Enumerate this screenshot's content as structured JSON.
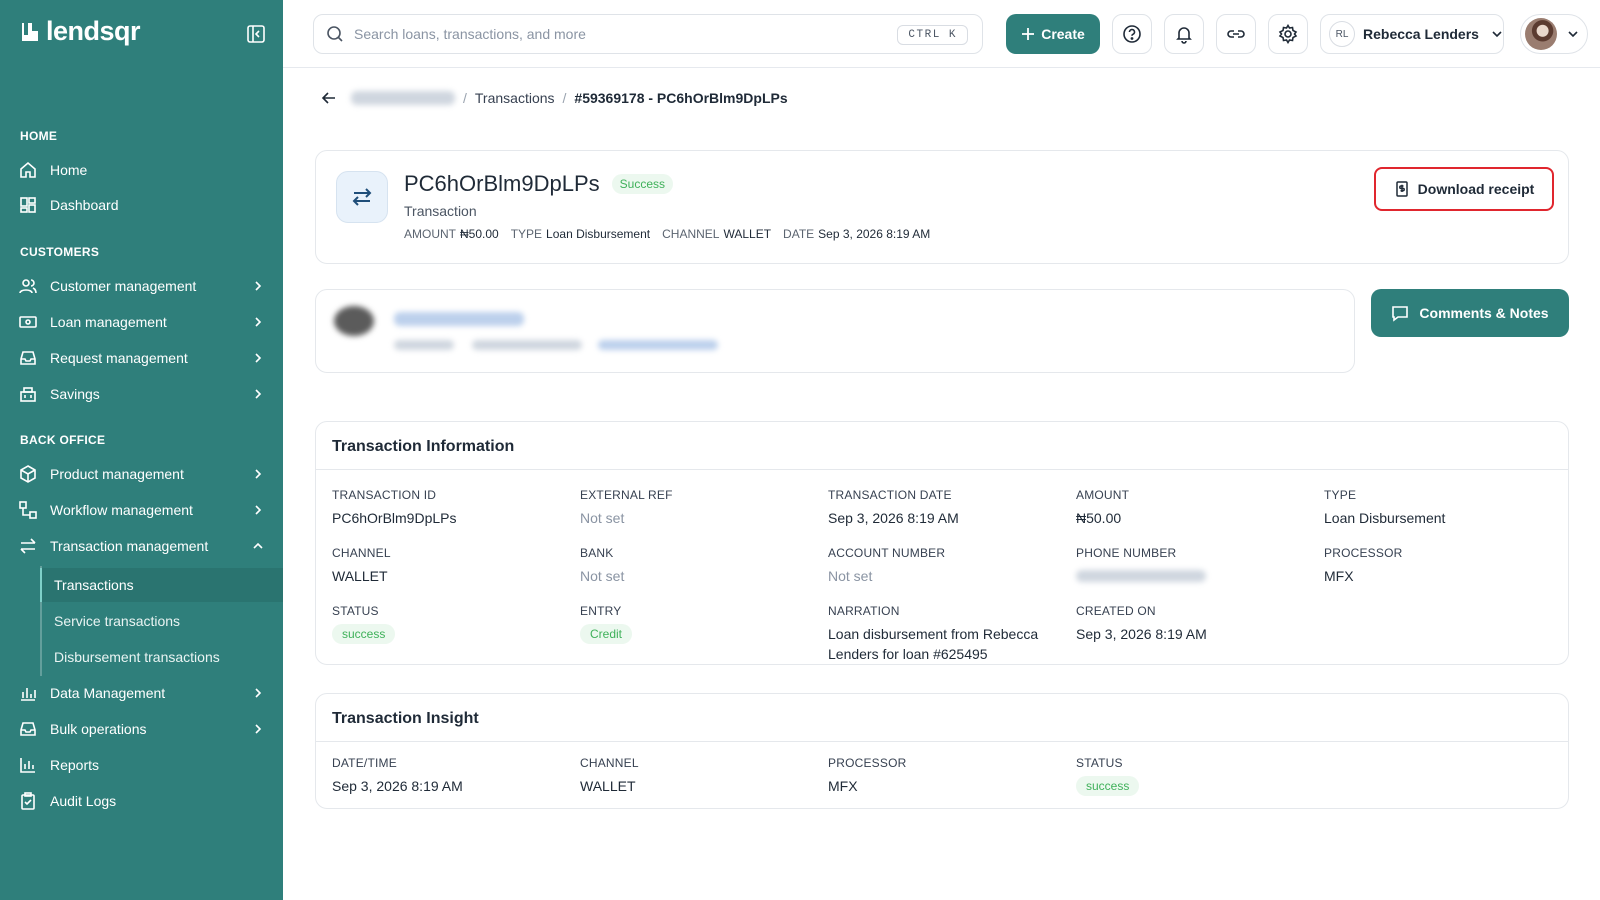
{
  "brand": {
    "name": "lendsqr"
  },
  "sidebar": {
    "sections": {
      "home": "HOME",
      "customers": "CUSTOMERS",
      "back_office": "BACK OFFICE"
    },
    "items": {
      "home": "Home",
      "dashboard": "Dashboard",
      "customer_management": "Customer management",
      "loan_management": "Loan management",
      "request_management": "Request management",
      "savings": "Savings",
      "product_management": "Product management",
      "workflow_management": "Workflow management",
      "transaction_management": "Transaction management",
      "data_management": "Data Management",
      "bulk_operations": "Bulk operations",
      "reports": "Reports",
      "audit_logs": "Audit Logs"
    },
    "sub_items": {
      "transactions": "Transactions",
      "service_transactions": "Service transactions",
      "disbursement_transactions": "Disbursement transactions"
    }
  },
  "topbar": {
    "search_placeholder": "Search loans, transactions, and more",
    "shortcut": "CTRL K",
    "create_label": "Create",
    "user_initials": "RL",
    "user_name": "Rebecca Lenders"
  },
  "breadcrumb": {
    "transactions": "Transactions",
    "current": "#59369178 - PC6hOrBlm9DpLPs"
  },
  "transaction": {
    "reference": "PC6hOrBlm9DpLPs",
    "status_badge": "Success",
    "subtitle": "Transaction",
    "meta": {
      "amount_label": "AMOUNT",
      "amount": "₦50.00",
      "type_label": "TYPE",
      "type": "Loan Disbursement",
      "channel_label": "CHANNEL",
      "channel": "WALLET",
      "date_label": "DATE",
      "date": "Sep 3, 2026 8:19 AM"
    },
    "download_label": "Download receipt"
  },
  "comments_label": "Comments & Notes",
  "info": {
    "title": "Transaction Information",
    "fields": {
      "transaction_id": {
        "label": "TRANSACTION ID",
        "value": "PC6hOrBlm9DpLPs"
      },
      "external_ref": {
        "label": "EXTERNAL REF",
        "value": "Not set"
      },
      "transaction_date": {
        "label": "TRANSACTION DATE",
        "value": "Sep 3, 2026 8:19 AM"
      },
      "amount": {
        "label": "AMOUNT",
        "value": "₦50.00"
      },
      "type": {
        "label": "TYPE",
        "value": "Loan Disbursement"
      },
      "channel": {
        "label": "CHANNEL",
        "value": "WALLET"
      },
      "bank": {
        "label": "BANK",
        "value": "Not set"
      },
      "account_number": {
        "label": "ACCOUNT NUMBER",
        "value": "Not set"
      },
      "phone_number": {
        "label": "PHONE NUMBER"
      },
      "processor": {
        "label": "PROCESSOR",
        "value": "MFX"
      },
      "status": {
        "label": "STATUS",
        "value": "success"
      },
      "entry": {
        "label": "ENTRY",
        "value": "Credit"
      },
      "narration": {
        "label": "NARRATION",
        "value": "Loan disbursement from Rebecca Lenders for loan #625495"
      },
      "created_on": {
        "label": "CREATED ON",
        "value": "Sep 3, 2026 8:19 AM"
      }
    }
  },
  "insight": {
    "title": "Transaction Insight",
    "fields": {
      "datetime": {
        "label": "DATE/TIME",
        "value": "Sep 3, 2026 8:19 AM"
      },
      "channel": {
        "label": "CHANNEL",
        "value": "WALLET"
      },
      "processor": {
        "label": "PROCESSOR",
        "value": "MFX"
      },
      "status": {
        "label": "STATUS",
        "value": "success"
      }
    }
  },
  "colors": {
    "brand": "#2f7f7b",
    "success": "#3fb15a",
    "highlight": "#e0262e"
  }
}
